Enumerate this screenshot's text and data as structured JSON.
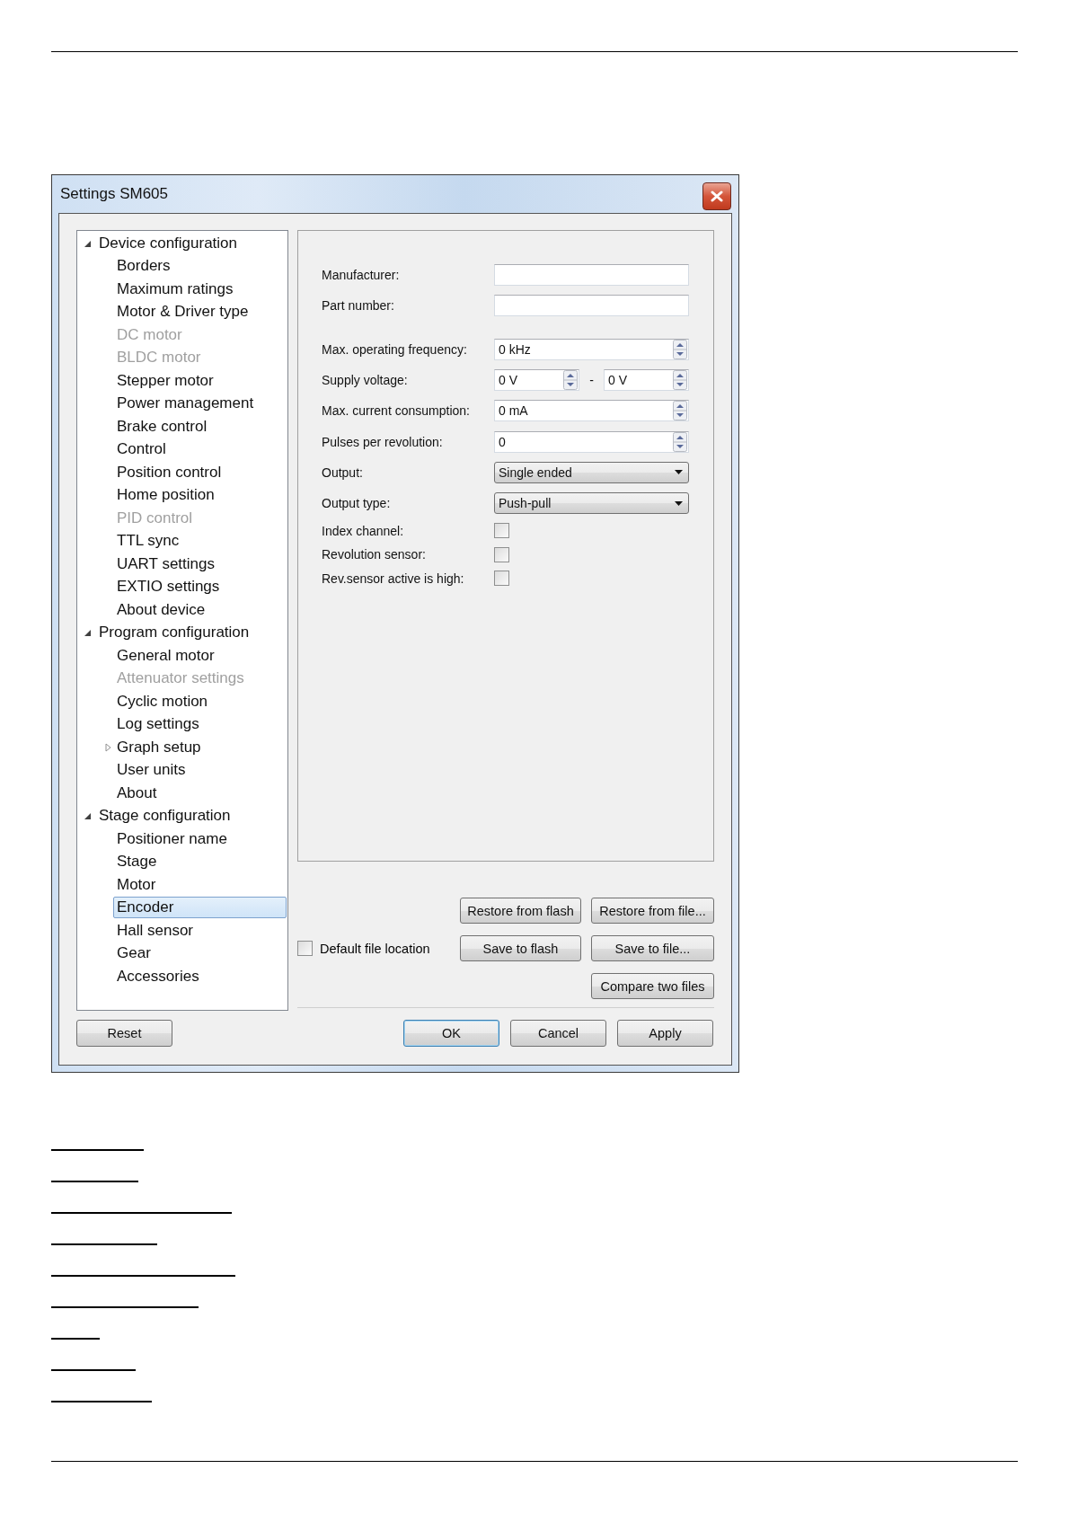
{
  "window": {
    "title": "Settings SM605"
  },
  "tree": {
    "items": [
      {
        "label": "Device configuration",
        "expanded": true,
        "disabled": false,
        "selected": false,
        "children": [
          {
            "label": "Borders",
            "disabled": false,
            "selected": false
          },
          {
            "label": "Maximum ratings",
            "disabled": false,
            "selected": false
          },
          {
            "label": "Motor & Driver type",
            "disabled": false,
            "selected": false
          },
          {
            "label": "DC motor",
            "disabled": true,
            "selected": false
          },
          {
            "label": "BLDC motor",
            "disabled": true,
            "selected": false
          },
          {
            "label": "Stepper motor",
            "disabled": false,
            "selected": false
          },
          {
            "label": "Power management",
            "disabled": false,
            "selected": false
          },
          {
            "label": "Brake control",
            "disabled": false,
            "selected": false
          },
          {
            "label": "Control",
            "disabled": false,
            "selected": false
          },
          {
            "label": "Position control",
            "disabled": false,
            "selected": false
          },
          {
            "label": "Home position",
            "disabled": false,
            "selected": false
          },
          {
            "label": "PID control",
            "disabled": true,
            "selected": false
          },
          {
            "label": "TTL sync",
            "disabled": false,
            "selected": false
          },
          {
            "label": "UART settings",
            "disabled": false,
            "selected": false
          },
          {
            "label": "EXTIO settings",
            "disabled": false,
            "selected": false
          },
          {
            "label": "About device",
            "disabled": false,
            "selected": false
          }
        ]
      },
      {
        "label": "Program configuration",
        "expanded": true,
        "disabled": false,
        "selected": false,
        "children": [
          {
            "label": "General motor",
            "disabled": false,
            "selected": false
          },
          {
            "label": "Attenuator settings",
            "disabled": true,
            "selected": false
          },
          {
            "label": "Cyclic motion",
            "disabled": false,
            "selected": false
          },
          {
            "label": "Log settings",
            "disabled": false,
            "selected": false
          },
          {
            "label": "Graph setup",
            "expanded": false,
            "disabled": false,
            "selected": false
          },
          {
            "label": "User units",
            "disabled": false,
            "selected": false
          },
          {
            "label": "About",
            "disabled": false,
            "selected": false
          }
        ]
      },
      {
        "label": "Stage configuration",
        "expanded": true,
        "disabled": false,
        "selected": false,
        "children": [
          {
            "label": "Positioner name",
            "disabled": false,
            "selected": false
          },
          {
            "label": "Stage",
            "disabled": false,
            "selected": false
          },
          {
            "label": "Motor",
            "disabled": false,
            "selected": false
          },
          {
            "label": "Encoder",
            "disabled": false,
            "selected": true
          },
          {
            "label": "Hall sensor",
            "disabled": false,
            "selected": false
          },
          {
            "label": "Gear",
            "disabled": false,
            "selected": false
          },
          {
            "label": "Accessories",
            "disabled": false,
            "selected": false
          }
        ]
      }
    ]
  },
  "form": {
    "fields": [
      {
        "kind": "text",
        "label": "Manufacturer:"
      },
      {
        "kind": "text",
        "label": "Part number:"
      },
      {
        "kind": "spin",
        "label": "Max. operating frequency:",
        "value": "0 kHz"
      },
      {
        "kind": "range",
        "label": "Supply voltage:",
        "value": "0 V",
        "separator": "-",
        "value_to": "0 V"
      },
      {
        "kind": "spin",
        "label": "Max. current consumption:",
        "value": "0 mA"
      },
      {
        "kind": "spin",
        "label": "Pulses per revolution:",
        "value": "0"
      },
      {
        "kind": "combo",
        "label": "Output:",
        "value": "Single ended"
      },
      {
        "kind": "combo",
        "label": "Output type:",
        "value": "Push-pull"
      },
      {
        "kind": "checkbox",
        "label": "Index channel:",
        "checked": false
      },
      {
        "kind": "checkbox",
        "label": "Revolution sensor:",
        "checked": false
      },
      {
        "kind": "checkbox",
        "label": "Rev.sensor active is high:",
        "checked": false
      }
    ]
  },
  "file_actions": {
    "default_location": {
      "label": "Default file location",
      "checked": false
    },
    "buttons": [
      "Restore from flash",
      "Restore from file...",
      "Save to flash",
      "Save to file...",
      "Compare two files"
    ]
  },
  "footer": {
    "reset": "Reset",
    "buttons": [
      {
        "label": "OK",
        "default": true
      },
      {
        "label": "Cancel",
        "default": false
      },
      {
        "label": "Apply",
        "default": false
      }
    ]
  }
}
